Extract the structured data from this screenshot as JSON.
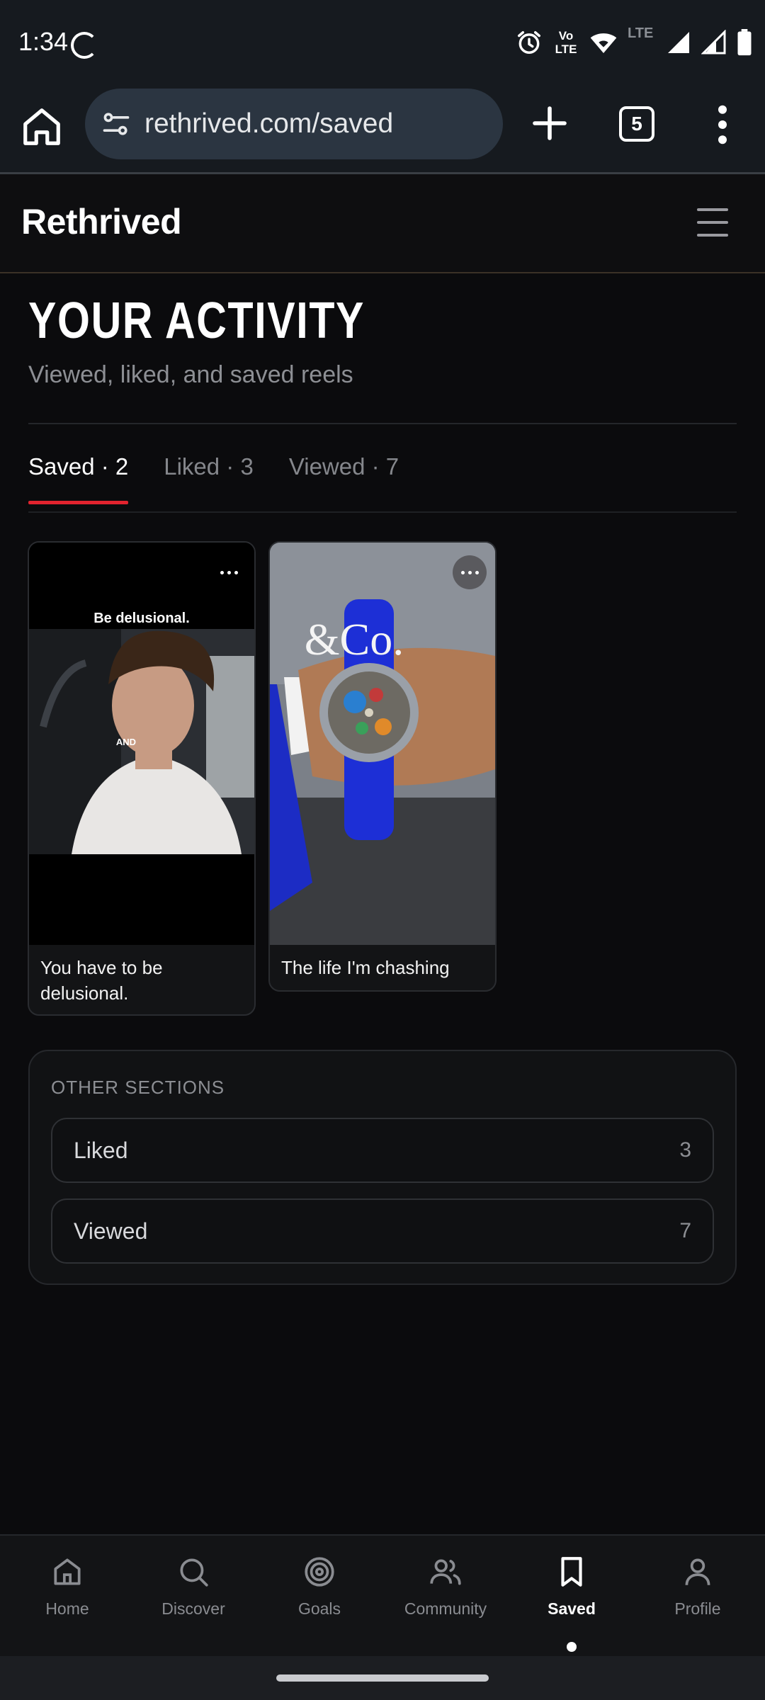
{
  "status_bar": {
    "time": "1:34",
    "icons": [
      "loading-spinner-icon",
      "alarm-icon",
      "volte-icon",
      "wifi-icon",
      "lte-icon",
      "signal-icon",
      "signal-icon",
      "battery-icon"
    ],
    "volte_label": "Vo LTE",
    "lte_label": "LTE"
  },
  "browser": {
    "url": "rethrived.com/saved",
    "tab_count": "5"
  },
  "site": {
    "brand": "Rethrived"
  },
  "page": {
    "title": "YOUR ACTIVITY",
    "subtitle": "Viewed, liked, and saved reels"
  },
  "tabs": [
    {
      "label": "Saved · 2",
      "active": true
    },
    {
      "label": "Liked · 3",
      "active": false
    },
    {
      "label": "Viewed · 7",
      "active": false
    }
  ],
  "cards": [
    {
      "caption": "You have to be delusional.",
      "overlay_top": "Be delusional.",
      "overlay_mid": "AND"
    },
    {
      "caption": "The life I'm chashing",
      "overlay_logo": "&Co."
    }
  ],
  "other_sections": {
    "title": "OTHER SECTIONS",
    "rows": [
      {
        "label": "Liked",
        "count": "3"
      },
      {
        "label": "Viewed",
        "count": "7"
      }
    ]
  },
  "bottom_nav": [
    {
      "label": "Home",
      "icon": "home-icon"
    },
    {
      "label": "Discover",
      "icon": "search-icon"
    },
    {
      "label": "Goals",
      "icon": "target-icon"
    },
    {
      "label": "Community",
      "icon": "users-icon"
    },
    {
      "label": "Saved",
      "icon": "bookmark-icon",
      "active": true
    },
    {
      "label": "Profile",
      "icon": "user-icon"
    }
  ],
  "colors": {
    "accent": "#e2232e",
    "background": "#0b0b0d",
    "browser_chrome": "#161a1f",
    "url_box": "#2b3541"
  }
}
